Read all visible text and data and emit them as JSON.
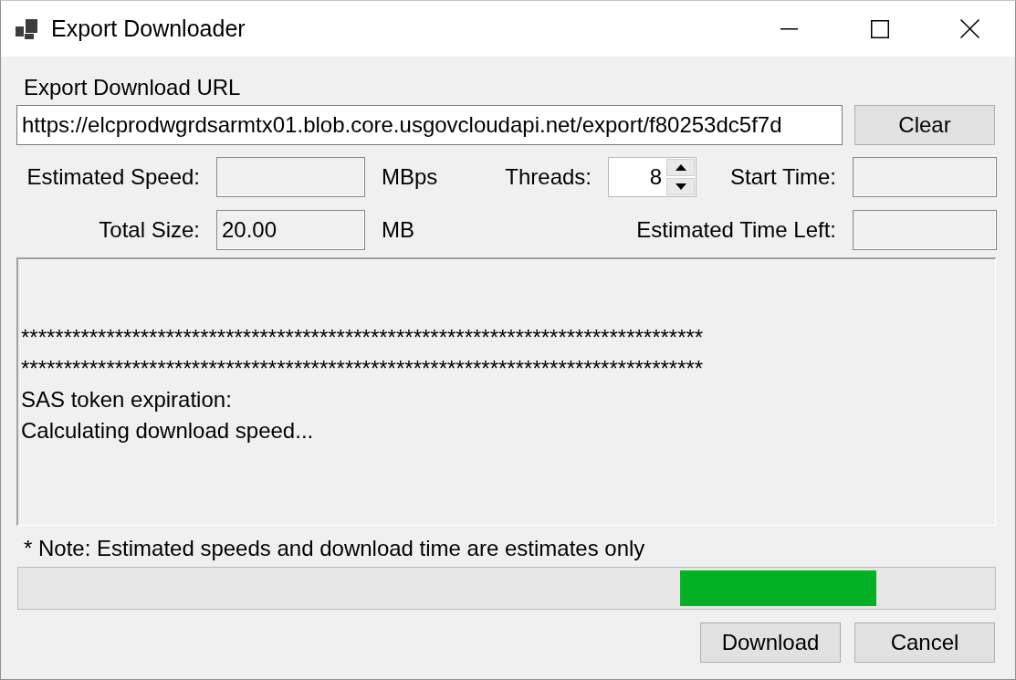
{
  "window": {
    "title": "Export Downloader"
  },
  "url": {
    "label": "Export Download URL",
    "value": "https://elcprodwgrdsarmtx01.blob.core.usgovcloudapi.net/export/f80253dc5f7d",
    "clear_button": "Clear"
  },
  "field_rows": [
    [
      {
        "kind": "text",
        "label": "Estimated Speed:",
        "unit": "MBps"
      },
      {
        "kind": "spinner",
        "label": "Threads:",
        "value": "8"
      },
      {
        "kind": "text",
        "label": "Start Time:"
      }
    ],
    [
      {
        "kind": "text",
        "label": "Total Size:",
        "value": "20.00",
        "unit": "MB"
      },
      {
        "kind": "text",
        "label": "Estimated Time Left:"
      }
    ]
  ],
  "log": {
    "lines": [
      "********************************************************************************",
      "********************************************************************************",
      "SAS token expiration:",
      "Calculating download speed..."
    ]
  },
  "note": "* Note: Estimated speeds and download time are estimates only",
  "progress": {
    "kind": "marquee"
  },
  "buttons": [
    "Download",
    "Cancel"
  ]
}
